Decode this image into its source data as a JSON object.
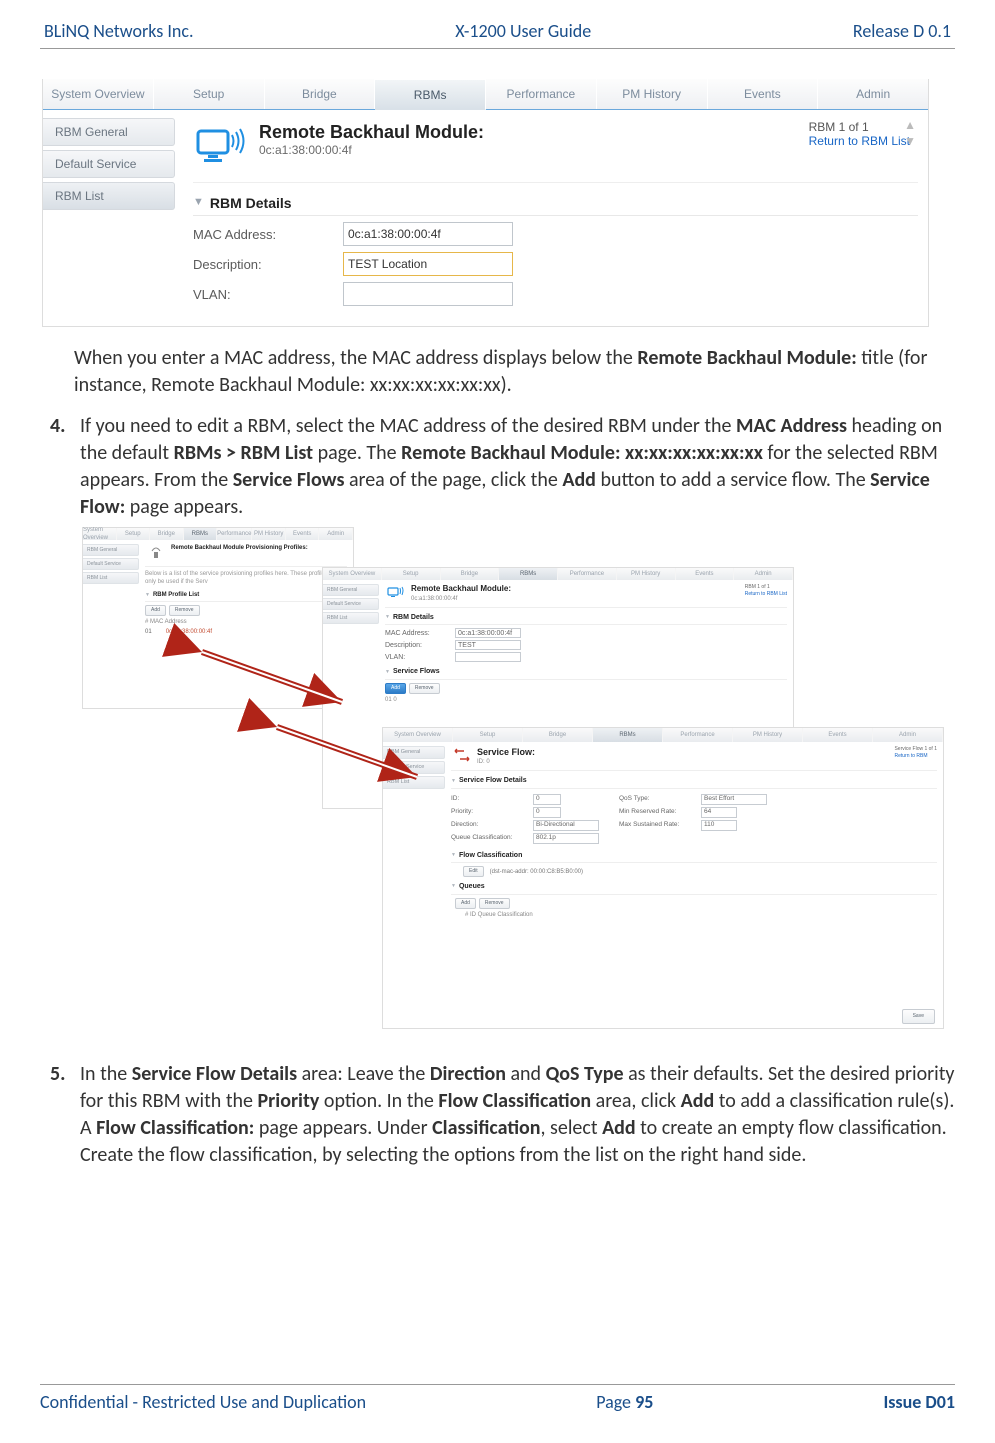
{
  "header": {
    "left": "BLiNQ Networks Inc.",
    "center": "X-1200 User Guide",
    "right": "Release D 0.1"
  },
  "footer": {
    "left": "Confidential - Restricted Use and Duplication",
    "center_prefix": "Page ",
    "page": "95",
    "right": "Issue D01"
  },
  "tabs": [
    "System Overview",
    "Setup",
    "Bridge",
    "RBMs",
    "Performance",
    "PM History",
    "Events",
    "Admin"
  ],
  "activeTab": "RBMs",
  "side": [
    {
      "label": "RBM General"
    },
    {
      "label": "Default Service"
    },
    {
      "label": "RBM List"
    }
  ],
  "rbm": {
    "title": "Remote Backhaul Module:",
    "mac": "0c:a1:38:00:00:4f",
    "counter": "RBM 1 of 1",
    "return": "Return to RBM List",
    "section": "RBM Details",
    "fields": {
      "mac_label": "MAC Address:",
      "mac_value": "0c:a1:38:00:00:4f",
      "desc_label": "Description:",
      "desc_value": "TEST Location",
      "vlan_label": "VLAN:",
      "vlan_value": ""
    }
  },
  "para1": {
    "t1": "When you enter a MAC address, the MAC address displays below the ",
    "b1": "Remote Backhaul Module:",
    "t2": " title (for instance, Remote Backhaul Module: xx:xx:xx:xx:xx:xx)."
  },
  "step4": {
    "num": "4.",
    "t1": "If you need to edit a RBM, select the MAC address of the desired RBM under the ",
    "b1": "MAC Address",
    "t2": " heading on the default ",
    "b2": "RBMs > RBM List",
    "t3": " page. The ",
    "b3": "Remote Backhaul Module: xx:xx:xx:xx:xx:xx",
    "t4": " for the selected RBM appears. From the ",
    "b4": "Service Flows",
    "t5": " area of the page, click the ",
    "b5": "Add",
    "t6": " button to add a service flow. The ",
    "b6": "Service Flow:",
    "t7": " page appears."
  },
  "step5": {
    "num": "5.",
    "t1": "In the ",
    "b1": "Service Flow Details",
    "t2": " area: Leave the ",
    "b2": "Direction",
    "t3": " and ",
    "b3": "QoS Type",
    "t4": " as their defaults. Set the desired priority for this RBM with the ",
    "b4": "Priority",
    "t5": " option. In the ",
    "b5": "Flow Classification",
    "t6": " area, click ",
    "b6": "Add",
    "t7": " to add a classification rule(s). A ",
    "b7": "Flow Classification:",
    "t8": " page appears. Under ",
    "b8": "Classification",
    "t9": ", select ",
    "b9": "Add",
    "t10": " to create an empty flow classification. Create the flow classification, by selecting the options from the list on the right hand side."
  },
  "shot2": {
    "layA": {
      "title": "Remote Backhaul Module Provisioning Profiles:",
      "sec": "RBM Profile List",
      "btn_add": "Add",
      "btn_rem": "Remove",
      "col_hdr": "#   MAC Address",
      "row": "01",
      "row_mac": "0c:a1:38:00:00:4f",
      "note": "Below is a list of the service provisioning profiles here. These profiles will only be used if the Serv"
    },
    "layB": {
      "title": "Remote Backhaul Module:",
      "mac": "0c:a1:38:00:00:4f",
      "counter": "RBM 1 of 1",
      "return": "Return to RBM List",
      "sec_details": "RBM Details",
      "mac_l": "MAC Address:",
      "mac_v": "0c:a1:38:00:00:4f",
      "desc_l": "Description:",
      "desc_v": "TEST",
      "vlan_l": "VLAN:",
      "sec_flows": "Service Flows",
      "btn_add": "Add",
      "btn_rem": "Remove",
      "row": "01    0"
    },
    "layC": {
      "title": "Service Flow:",
      "id": "ID: 0",
      "counter": "Service Flow 1 of 1",
      "return": "Return to RBM",
      "sec_details": "Service Flow Details",
      "id_l": "ID:",
      "id_v": "0",
      "pri_l": "Priority:",
      "pri_v": "0",
      "dir_l": "Direction:",
      "dir_v": "Bi-Directional",
      "qc_l": "Queue Classification:",
      "qc_v": "802.1p",
      "qos_l": "QoS Type:",
      "qos_v": "Best Effort",
      "minr_l": "Min Reserved Rate:",
      "minr_v": "64",
      "maxs_l": "Max Sustained Rate:",
      "maxs_v": "110",
      "sec_flow": "Flow Classification",
      "fc_edit": "Edit",
      "fc_text": "(dst-mac-addr: 00:00:C8:B5:B0:00)",
      "sec_queues": "Queues",
      "q_add": "Add",
      "q_rem": "Remove",
      "q_row": "#   ID    Queue Classification",
      "btn_save": "Save"
    }
  }
}
